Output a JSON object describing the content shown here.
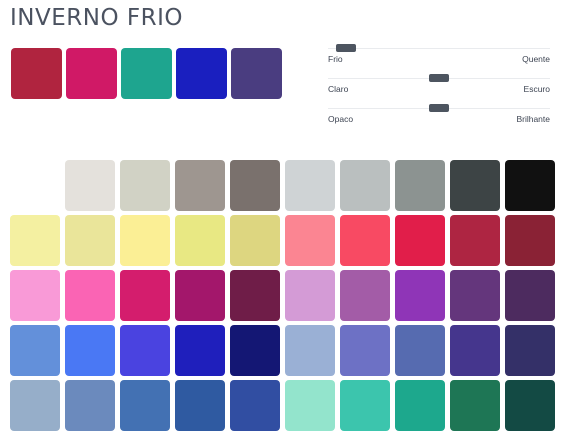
{
  "title": "INVERNO FRIO",
  "key_colors": [
    "#b0243f",
    "#d01966",
    "#1ea58f",
    "#1a1fbf",
    "#4a3d80"
  ],
  "sliders": [
    {
      "left_label": "Frio",
      "right_label": "Quente",
      "value": 0.04
    },
    {
      "left_label": "Claro",
      "right_label": "Escuro",
      "value": 0.5
    },
    {
      "left_label": "Opaco",
      "right_label": "Brilhante",
      "value": 0.5
    }
  ],
  "palette": [
    [
      "#ffffff",
      "#e4e1dc",
      "#d1d2c5",
      "#9e9690",
      "#7a716d",
      "#cfd3d5",
      "#babfbf",
      "#8c9391",
      "#3d4445",
      "#111111"
    ],
    [
      "#f4f0a1",
      "#eae59a",
      "#fbef95",
      "#e8e883",
      "#ddd680",
      "#fb8592",
      "#f84a63",
      "#e11e4a",
      "#ae2542",
      "#8a2235"
    ],
    [
      "#f99ad7",
      "#fa64b4",
      "#d41d6d",
      "#a3176b",
      "#6f1d48",
      "#d49bd6",
      "#a35ca7",
      "#8f35b7",
      "#64367c",
      "#4d2b5f"
    ],
    [
      "#6390da",
      "#4a78f4",
      "#4a43e0",
      "#1f1fbc",
      "#141774",
      "#9ab0d5",
      "#6d71c5",
      "#566bb0",
      "#45368d",
      "#343068"
    ],
    [
      "#96aec9",
      "#6b8abd",
      "#4371b3",
      "#2f5aa1",
      "#314ea2",
      "#93e4cc",
      "#3cc5ad",
      "#1da88d",
      "#1e7655",
      "#134a44"
    ]
  ]
}
